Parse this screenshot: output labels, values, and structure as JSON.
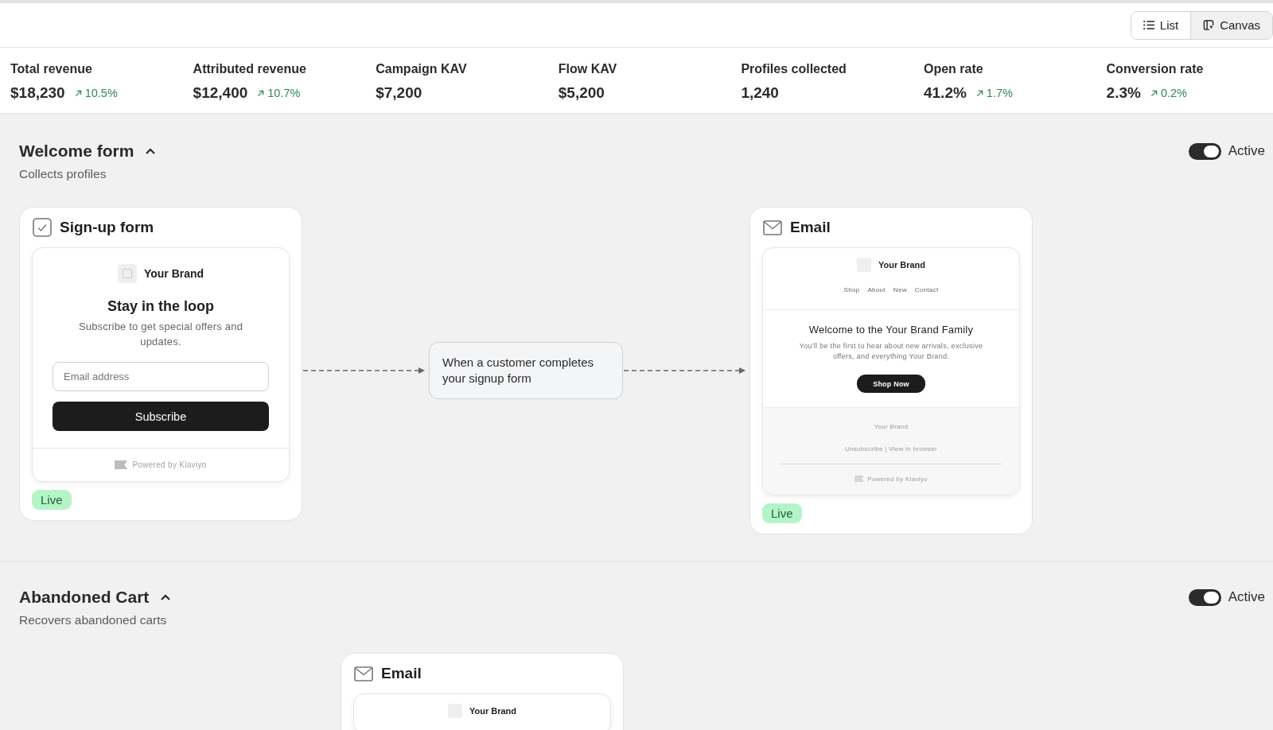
{
  "view_switcher": [
    {
      "label": "List",
      "selected": false
    },
    {
      "label": "Canvas",
      "selected": true
    }
  ],
  "metrics": [
    {
      "label": "Total revenue",
      "value": "$18,230",
      "change": "10.5%"
    },
    {
      "label": "Attributed revenue",
      "value": "$12,400",
      "change": "10.7%"
    },
    {
      "label": "Campaign KAV",
      "value": "$7,200"
    },
    {
      "label": "Flow KAV",
      "value": "$5,200"
    },
    {
      "label": "Profiles collected",
      "value": "1,240"
    },
    {
      "label": "Open rate",
      "value": "41.2%",
      "change": "1.7%"
    },
    {
      "label": "Conversion rate",
      "value": "2.3%",
      "change": "0.2%"
    }
  ],
  "flows": [
    {
      "title": "Welcome form",
      "expanded": true,
      "subtitle": "Collects profiles",
      "toggle": {
        "label": "Active",
        "on": true
      },
      "steps": [
        {
          "kind": "signup_form",
          "title": "Sign-up form",
          "preview": {
            "brand": "Your Brand",
            "heading": "Stay in the loop",
            "text": "Subscribe to get special offers and updates.",
            "placeholder": "Email address",
            "button": "Subscribe",
            "footer": "Powered by Klaviyo"
          },
          "status": "Live"
        },
        {
          "kind": "trigger",
          "text": "When a customer completes your signup form"
        },
        {
          "kind": "email",
          "title": "Email",
          "preview": {
            "brand": "Your Brand",
            "nav": [
              "Shop",
              "About",
              "New",
              "Contact"
            ],
            "heading": "Welcome to the Your Brand Family",
            "text": "You'll be the first to hear about new arrivals, exclusive offers, and everything Your Brand.",
            "button": "Shop Now",
            "footer_brand": "Your Brand",
            "footer_links": "Unsubscribe | View in browser",
            "footer": "Powered by Klaviyo"
          },
          "status": "Live"
        }
      ]
    },
    {
      "title": "Abandoned Cart",
      "expanded": true,
      "subtitle": "Recovers abandoned carts",
      "toggle": {
        "label": "Active",
        "on": true
      },
      "steps": [
        {
          "kind": "email",
          "title": "Email",
          "preview": {
            "brand": "Your Brand"
          }
        }
      ]
    }
  ]
}
